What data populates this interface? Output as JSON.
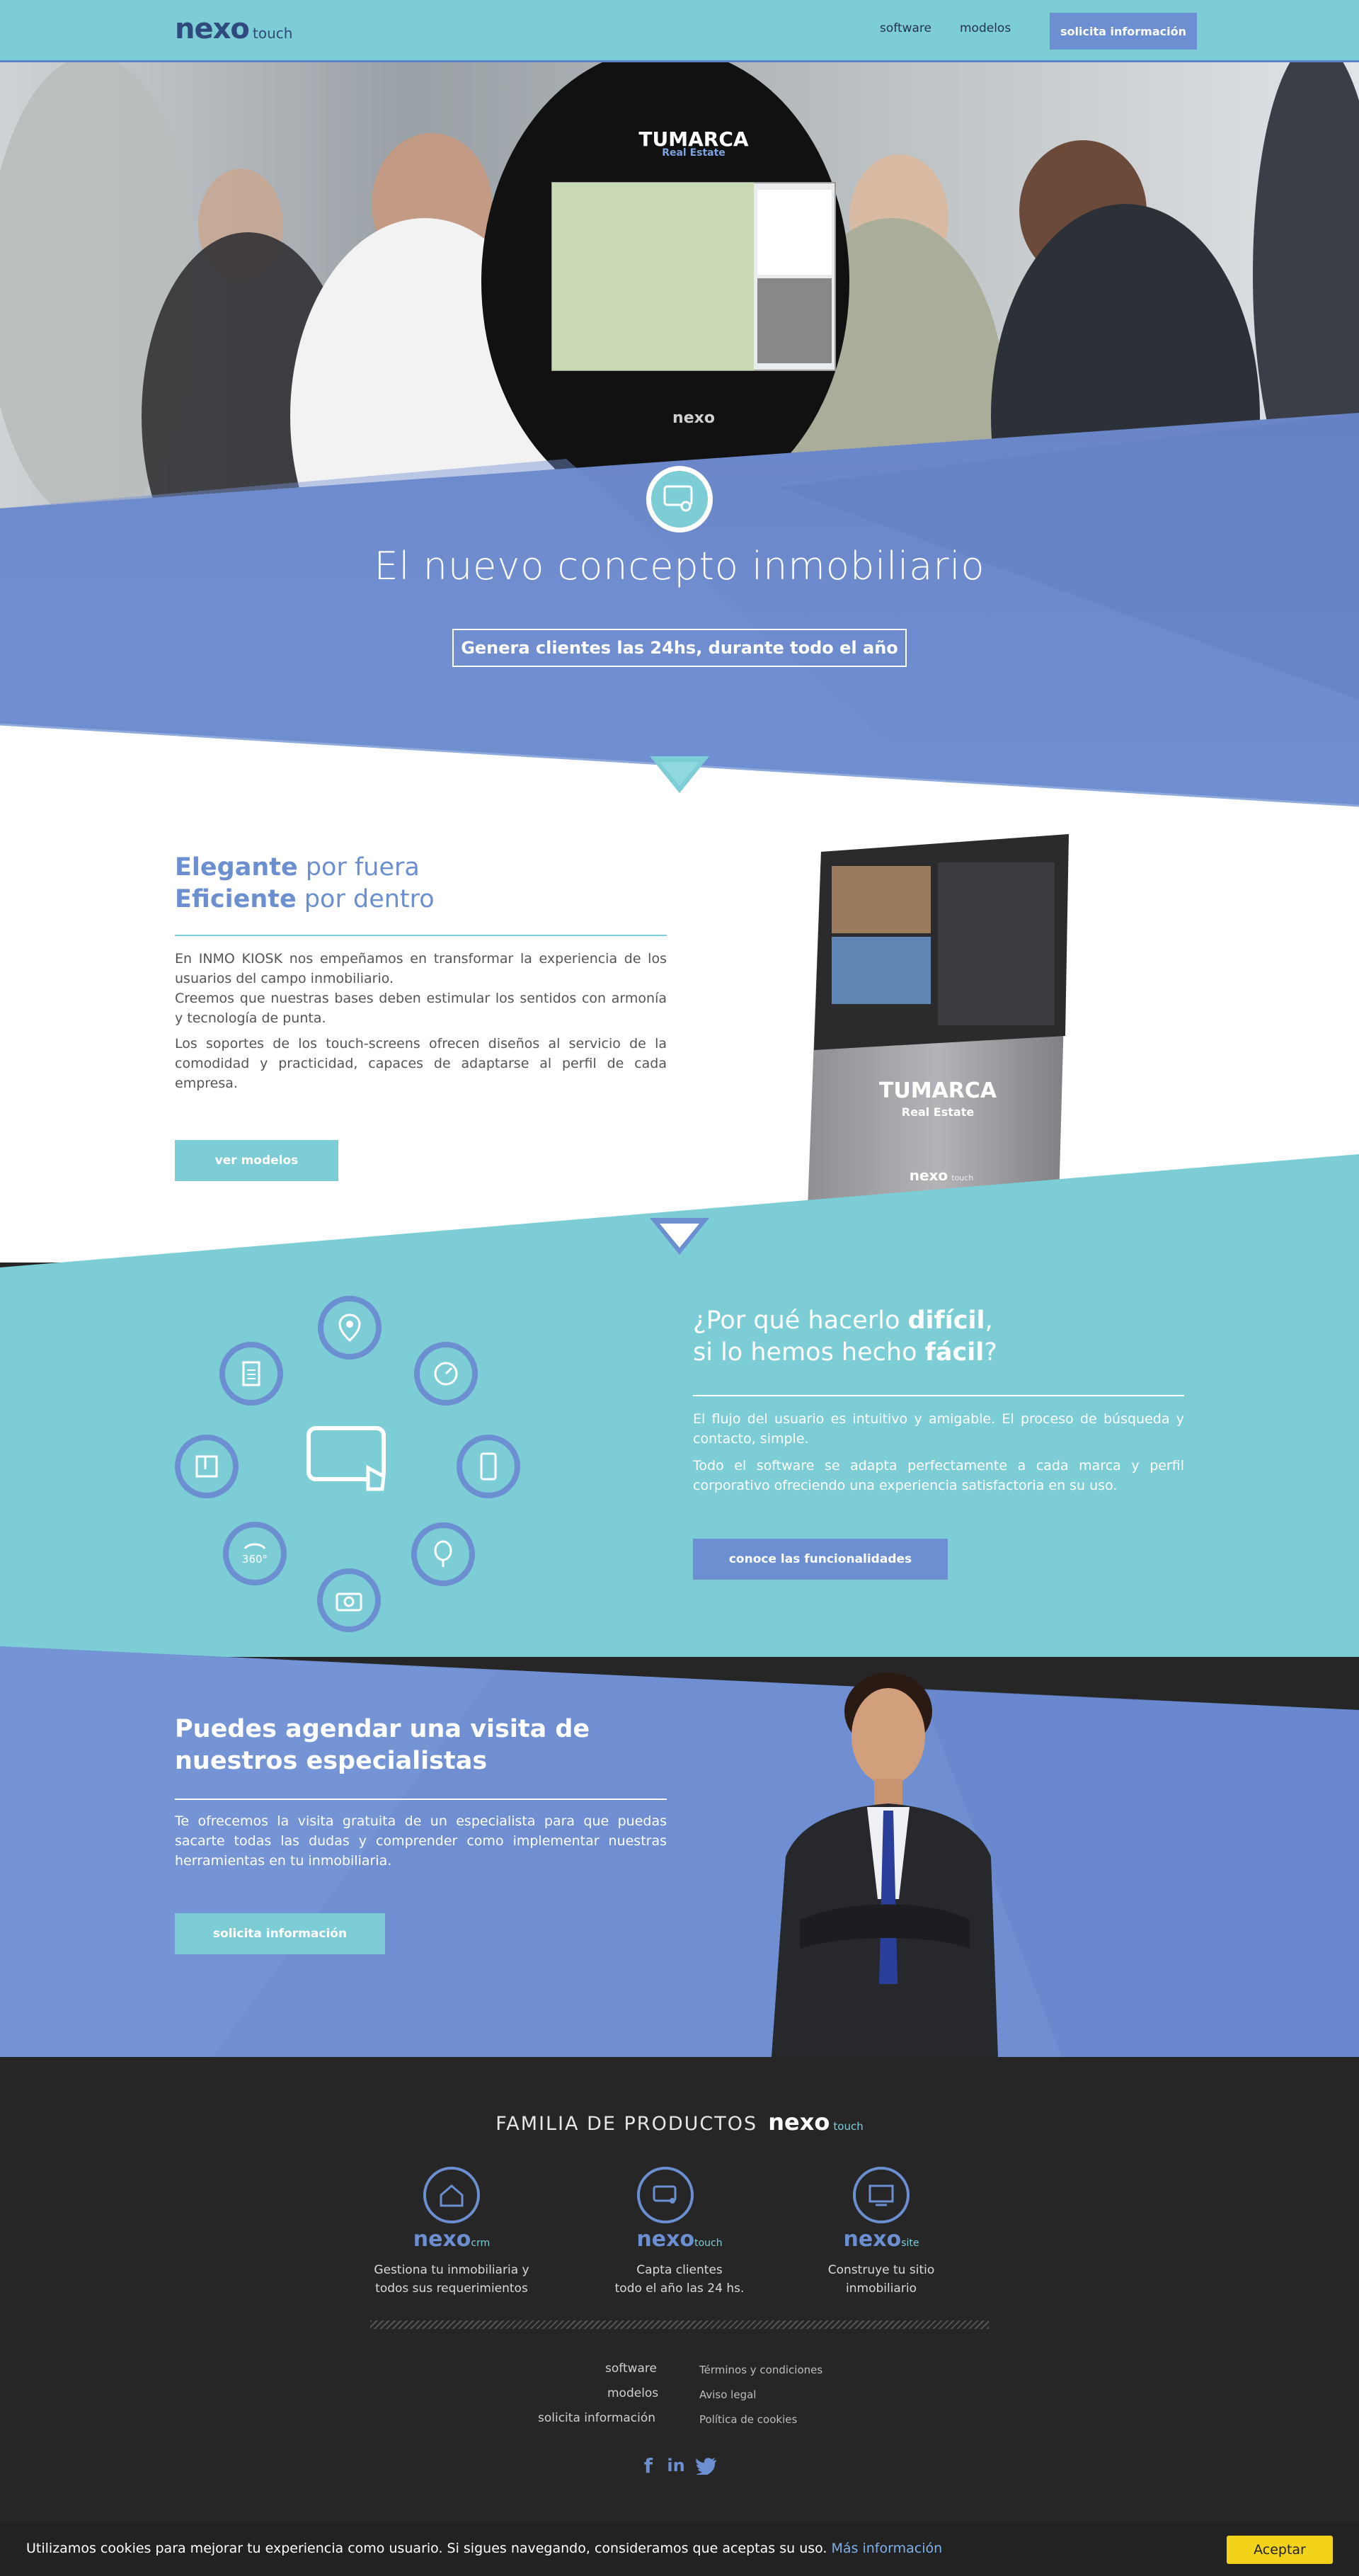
{
  "header": {
    "logo_main": "nexo",
    "logo_sub": "touch",
    "nav": [
      "software",
      "modelos"
    ],
    "cta": "solicita información"
  },
  "hero": {
    "kiosk_brand_line1": "TUMARCA",
    "kiosk_brand_line2": "Real Estate",
    "kiosk_footer_logo": "nexo",
    "title": "El nuevo concepto inmobiliario",
    "cta": "Genera clientes las 24hs, durante todo el año"
  },
  "section_elegante": {
    "title_line1_bold": "Elegante",
    "title_line1_rest": " por fuera",
    "title_line2_bold": "Eficiente",
    "title_line2_rest": " por dentro",
    "paragraphs": [
      "En INMO KIOSK nos empeñamos en transformar la experiencia de los usuarios del campo inmobiliario.",
      "Creemos que nuestras bases deben estimular los sentidos con armonía y tecnología de punta.",
      "Los soportes de los touch-screens ofrecen diseños al servicio de la comodidad y practicidad, capaces de adaptarse al perfil de cada empresa."
    ],
    "button": "ver modelos",
    "kiosk_brand_line1": "TUMARCA",
    "kiosk_brand_line2": "Real Estate",
    "kiosk_logo": "nexo",
    "kiosk_logo_sub": "touch"
  },
  "section_facil": {
    "title_pre": "¿Por qué hacerlo ",
    "title_bold1": "difícil",
    "title_mid": ",",
    "title_line2_pre": "si lo hemos hecho ",
    "title_bold2": "fácil",
    "title_end": "?",
    "paragraphs": [
      "El flujo del usuario es intuitivo y amigable. El proceso de búsqueda y contacto, simple.",
      "Todo el software se adapta perfectamente a cada marca y perfil corporativo ofreciendo una experiencia satisfactoria en su uso."
    ],
    "button": "conoce las funcionalidades",
    "icon_360_label": "360°",
    "icons": [
      "location-icon",
      "speed-icon",
      "mobile-icon",
      "tree-icon",
      "camera-icon",
      "360-icon",
      "floorplan-icon",
      "document-icon",
      "touch-screen-icon"
    ]
  },
  "section_visita": {
    "title": "Puedes agendar una visita de nuestros especialistas",
    "paragraph": "Te ofrecemos la visita gratuita de un especialista para que puedas sacarte todas las dudas y comprender como implementar nuestras herramientas en tu inmobiliaria.",
    "button": "solicita información"
  },
  "footer": {
    "family_title": "FAMILIA DE PRODUCTOS",
    "family_logo": "nexo",
    "family_logo_sub": "touch",
    "products": [
      {
        "logo": "nexo",
        "sub": "crm",
        "desc1": "Gestiona tu inmobiliaria y",
        "desc2": "todos sus requerimientos"
      },
      {
        "logo": "nexo",
        "sub": "touch",
        "desc1": "Capta clientes",
        "desc2": "todo el año las 24 hs."
      },
      {
        "logo": "nexo",
        "sub": "site",
        "desc1": "Construye tu sitio",
        "desc2": "inmobiliario"
      }
    ],
    "links_left": [
      "software",
      "modelos",
      "solicita información"
    ],
    "links_right": [
      "Términos y condiciones",
      "Aviso legal",
      "Política de cookies"
    ],
    "social": [
      "facebook-icon",
      "linkedin-icon",
      "twitter-icon"
    ]
  },
  "cookie": {
    "text": "Utilizamos cookies para mejorar tu experiencia como usuario. Si sigues navegando, consideramos que aceptas su uso.",
    "link": "Más información",
    "button": "Aceptar"
  },
  "colors": {
    "teal": "#7ccdd6",
    "blue": "#6b8fd0",
    "dark_blue": "#2f4a7c",
    "footer_bg": "#262626",
    "cookie_btn": "#f3d31a"
  }
}
